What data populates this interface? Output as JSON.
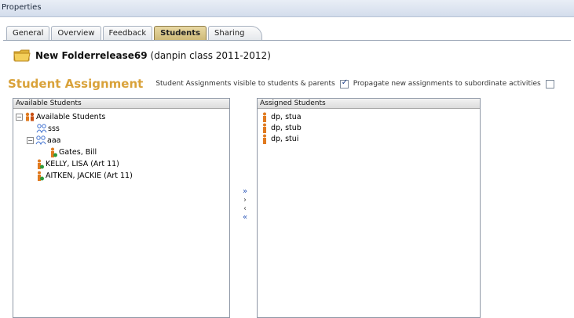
{
  "window": {
    "title": "Properties"
  },
  "tabs": [
    {
      "label": "General",
      "active": false
    },
    {
      "label": "Overview",
      "active": false
    },
    {
      "label": "Feedback",
      "active": false
    },
    {
      "label": "Students",
      "active": true
    },
    {
      "label": "Sharing",
      "active": false
    }
  ],
  "folder": {
    "name": "New Folderrelease69",
    "class_label": "(danpin class 2011-2012)"
  },
  "assignment": {
    "title": "Student Assignment",
    "visible_label": "Student Assignments visible to students & parents",
    "visible_checked": true,
    "propagate_label": "Propagate new assignments to subordinate activities",
    "propagate_checked": false
  },
  "available": {
    "header": "Available Students",
    "tree": [
      {
        "label": "Available Students",
        "level": 0,
        "type": "root",
        "expander": "−"
      },
      {
        "label": "sss",
        "level": 1,
        "type": "group"
      },
      {
        "label": "aaa",
        "level": 1,
        "type": "group",
        "expander": "−"
      },
      {
        "label": "Gates, Bill",
        "level": 2,
        "type": "student"
      },
      {
        "label": "KELLY, LISA (Art 11)",
        "level": 1,
        "type": "student"
      },
      {
        "label": "AITKEN, JACKIE (Art 11)",
        "level": 1,
        "type": "student"
      }
    ]
  },
  "assigned": {
    "header": "Assigned Students",
    "items": [
      {
        "label": "dp, stua"
      },
      {
        "label": "dp, stub"
      },
      {
        "label": "dp, stui"
      }
    ]
  },
  "transfer_buttons": {
    "add_all": "»",
    "add_one": "›",
    "remove_one": "‹",
    "remove_all": "«"
  },
  "colors": {
    "accent_title": "#d9a23a",
    "active_tab": "#cdb876",
    "arrow_blue": "#2b56b8"
  }
}
